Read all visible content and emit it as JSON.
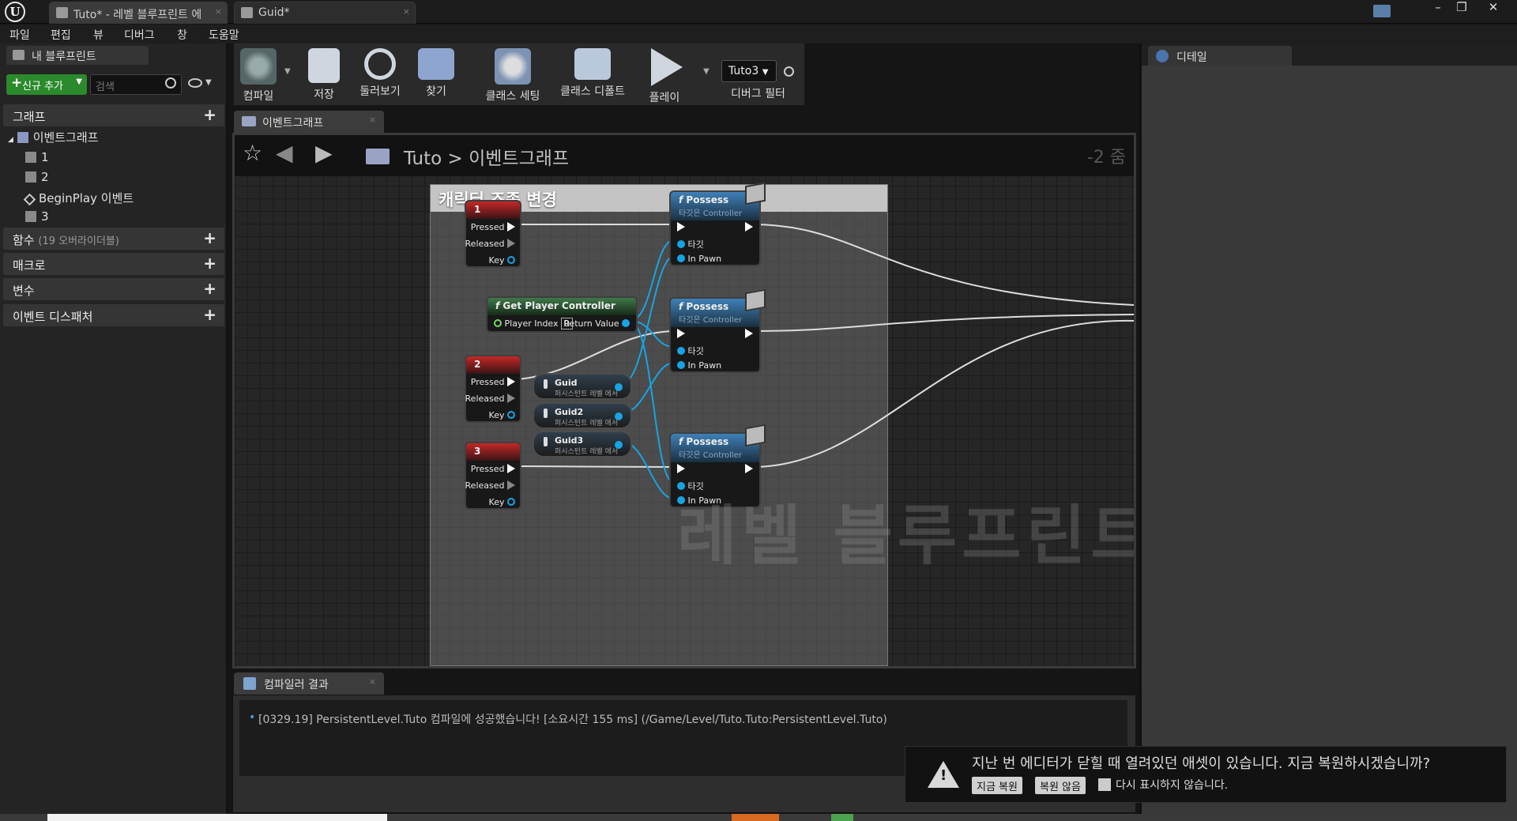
{
  "tabs": [
    {
      "label": "Tuto* - 레벨 블루프린트 에"
    },
    {
      "label": "Guid*"
    }
  ],
  "window_buttons": {
    "minimize": "–",
    "restore": "❐",
    "close": "✕"
  },
  "menu": [
    "파일",
    "편집",
    "뷰",
    "디버그",
    "창",
    "도움말"
  ],
  "left_panel": {
    "tab": "내 블루프린트",
    "add_button": "신규 추가",
    "search_placeholder": "검색",
    "sections": {
      "graph": "그래프",
      "functions": "함수",
      "functions_count": "(19 오버라이더블)",
      "macros": "매크로",
      "variables": "변수",
      "dispatchers": "이벤트 디스패처"
    },
    "tree": {
      "event_graph": "이벤트그래프",
      "items": [
        "1",
        "2",
        "BeginPlay 이벤트",
        "3"
      ]
    }
  },
  "toolbar": {
    "compile": "컴파일",
    "save": "저장",
    "browse": "둘러보기",
    "find": "찾기",
    "class_settings": "클래스 세팅",
    "class_defaults": "클래스 디폴트",
    "play": "플레이",
    "debug_object": "Tuto3",
    "debug_filter": "디버그 필터"
  },
  "graph": {
    "tab": "이벤트그래프",
    "breadcrumb": {
      "root": "Tuto",
      "sep": ">",
      "current": "이벤트그래프"
    },
    "zoom": "-2 줌",
    "comment": "캐릭터 조종 변경",
    "watermark": "레벨 블루프린트",
    "key_events": [
      {
        "title": "1"
      },
      {
        "title": "2"
      },
      {
        "title": "3"
      }
    ],
    "key_pins": {
      "pressed": "Pressed",
      "released": "Released",
      "key": "Key"
    },
    "get_player_controller": {
      "title": "Get Player Controller",
      "player_index": "Player Index",
      "index_value": "0",
      "return_value": "Return Value"
    },
    "variables": [
      {
        "name": "Guid",
        "sub": "퍼시스턴트 레벨 에서"
      },
      {
        "name": "Guid2",
        "sub": "퍼시스턴트 레벨 에서"
      },
      {
        "name": "Guid3",
        "sub": "퍼시스턴트 레벨 에서"
      }
    ],
    "possess": {
      "title": "Possess",
      "subtitle": "타깃은 Controller",
      "target": "타깃",
      "in_pawn": "In Pawn"
    }
  },
  "details_panel": {
    "tab": "디테일"
  },
  "compiler": {
    "tab": "컴파일러 결과",
    "log": "[0329.19] PersistentLevel.Tuto 컴파일에 성공했습니다! [소요시간 155 ms] (/Game/Level/Tuto.Tuto:PersistentLevel.Tuto)"
  },
  "notification": {
    "message": "지난 번 에디터가 닫힐 때 열려있던 애셋이 있습니다. 지금 복원하시겠습니까?",
    "restore_button": "지금 복원",
    "no_restore_button": "복원 않음",
    "dont_show": "다시 표시하지 않습니다."
  },
  "colors": {
    "key_event_header": "#c42828",
    "function_header": "#3f80b8",
    "pure_header": "#40784a",
    "object_pin": "#17a4e4",
    "add_button": "#2b8a2b"
  }
}
